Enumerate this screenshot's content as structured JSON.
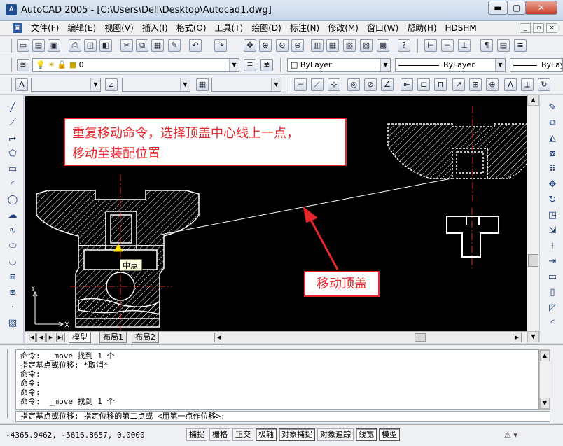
{
  "window": {
    "title": "AutoCAD 2005 - [C:\\Users\\Dell\\Desktop\\Autocad1.dwg]",
    "app_icon_glyph": "A",
    "min_glyph": "▬",
    "max_glyph": "▢",
    "close_glyph": "✕"
  },
  "menu": {
    "items": [
      "文件(F)",
      "编辑(E)",
      "视图(V)",
      "插入(I)",
      "格式(O)",
      "工具(T)",
      "绘图(D)",
      "标注(N)",
      "修改(M)",
      "窗口(W)",
      "帮助(H)",
      "HDSHM"
    ],
    "mdi_min": "_",
    "mdi_restore": "▫",
    "mdi_close": "×"
  },
  "layers_toolbar": {
    "layer_value": "0",
    "color_value": "ByLayer",
    "linetype_value": "ByLayer",
    "lineweight_value": "ByLay"
  },
  "drawing": {
    "ucs_y": "Y",
    "ucs_x": "X",
    "snap_tooltip": "中点",
    "colors": {
      "background": "#000000",
      "lines": "#ffffff",
      "center_line": "#e8262b",
      "snap_marker": "#ffe000"
    }
  },
  "layout_tabs": [
    "模型",
    "布局1",
    "布局2"
  ],
  "command_line": {
    "history": [
      "命令:  _move 找到 1 个",
      "指定基点或位移: *取消*",
      "命令:",
      "命令:",
      "命令:",
      "命令:  _move 找到 1 个"
    ],
    "prompt": "指定基点或位移: 指定位移的第二点或 <用第一点作位移>:"
  },
  "status": {
    "coordinates": "-4365.9462, -5616.8657, 0.0000",
    "buttons": [
      {
        "label": "捕捉",
        "on": false
      },
      {
        "label": "栅格",
        "on": false
      },
      {
        "label": "正交",
        "on": false
      },
      {
        "label": "极轴",
        "on": true
      },
      {
        "label": "对象捕捉",
        "on": true
      },
      {
        "label": "对象追踪",
        "on": false
      },
      {
        "label": "线宽",
        "on": true
      },
      {
        "label": "模型",
        "on": true
      }
    ]
  },
  "annotations": {
    "callout1_line1": "重复移动命令，选择顶盖中心线上一点，",
    "callout1_line2": "移动至装配位置",
    "callout2": "移动顶盖",
    "color": "#e5262b"
  }
}
